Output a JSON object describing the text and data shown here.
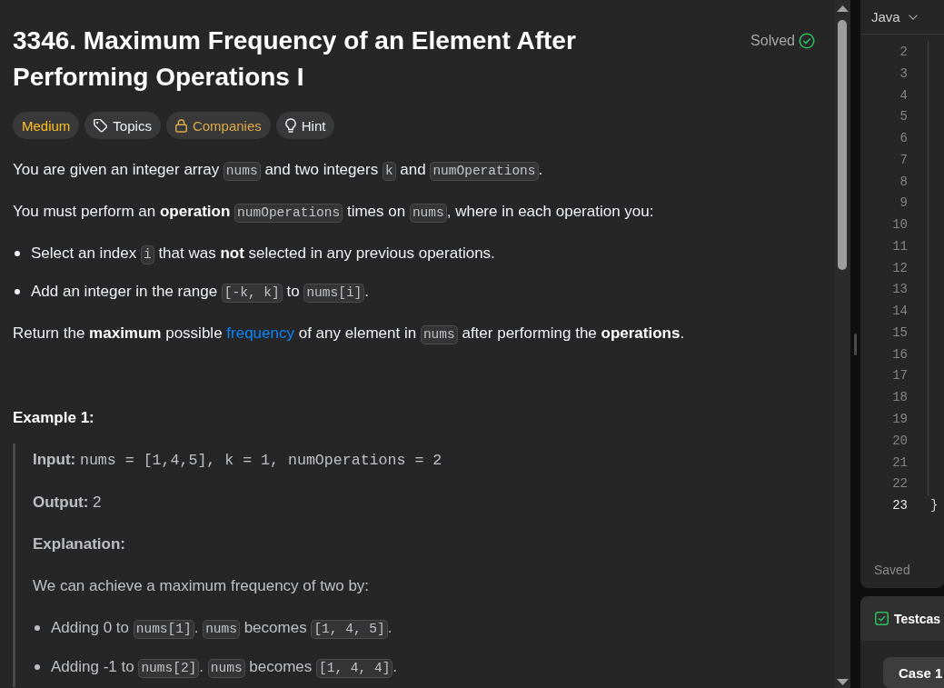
{
  "problem": {
    "title": "3346. Maximum Frequency of an Element After Performing Operations I",
    "status": {
      "label": "Solved",
      "solved": true
    },
    "tags": [
      {
        "kind": "difficulty",
        "label": "Medium"
      },
      {
        "kind": "topics",
        "label": "Topics"
      },
      {
        "kind": "companies",
        "label": "Companies",
        "locked": true
      },
      {
        "kind": "hint",
        "label": "Hint"
      }
    ],
    "description": [
      {
        "kind": "paragraph",
        "parts": [
          {
            "kind": "text",
            "text": "You are given an integer array "
          },
          {
            "kind": "code",
            "text": "nums"
          },
          {
            "kind": "text",
            "text": " and two integers "
          },
          {
            "kind": "code",
            "text": "k"
          },
          {
            "kind": "text",
            "text": " and "
          },
          {
            "kind": "code",
            "text": "numOperations"
          },
          {
            "kind": "text",
            "text": "."
          }
        ]
      },
      {
        "kind": "paragraph",
        "parts": [
          {
            "kind": "text",
            "text": "You must perform an **operation** "
          },
          {
            "kind": "code",
            "text": "numOperations"
          },
          {
            "kind": "text",
            "text": " times on "
          },
          {
            "kind": "code",
            "text": "nums"
          },
          {
            "kind": "text",
            "text": ", where in each operation you:"
          }
        ]
      },
      {
        "kind": "bullets",
        "items": [
          {
            "parts": [
              {
                "kind": "text",
                "text": "Select an index "
              },
              {
                "kind": "code",
                "text": "i"
              },
              {
                "kind": "text",
                "text": " that was **not** selected in any previous operations."
              }
            ]
          },
          {
            "parts": [
              {
                "kind": "text",
                "text": "Add an integer in the range "
              },
              {
                "kind": "code",
                "text": "[-k, k]"
              },
              {
                "kind": "text",
                "text": " to "
              },
              {
                "kind": "code",
                "text": "nums[i]"
              },
              {
                "kind": "text",
                "text": "."
              }
            ]
          }
        ]
      },
      {
        "kind": "paragraph",
        "parts": [
          {
            "kind": "text",
            "text": "Return the **maximum** possible "
          },
          {
            "kind": "link",
            "text": "frequency"
          },
          {
            "kind": "text",
            "text": " of any element in "
          },
          {
            "kind": "code",
            "text": "nums"
          },
          {
            "kind": "text",
            "text": " after performing the **operations**."
          }
        ]
      }
    ],
    "examples": [
      {
        "heading": "Example 1:",
        "blocks": [
          {
            "kind": "paragraph",
            "parts": [
              {
                "kind": "text",
                "text": "**Input:** "
              },
              {
                "kind": "mono",
                "text": "nums = [1,4,5], k = 1, numOperations = 2"
              }
            ]
          },
          {
            "kind": "paragraph",
            "parts": [
              {
                "kind": "text",
                "text": "**Output:** 2"
              }
            ]
          },
          {
            "kind": "label",
            "text": "Explanation:"
          },
          {
            "kind": "paragraph",
            "parts": [
              {
                "kind": "text",
                "text": "We can achieve a maximum frequency of two by:"
              }
            ]
          },
          {
            "kind": "bullets",
            "items": [
              {
                "parts": [
                  {
                    "kind": "text",
                    "text": "Adding 0 to "
                  },
                  {
                    "kind": "code",
                    "text": "nums[1]"
                  },
                  {
                    "kind": "text",
                    "text": ". "
                  },
                  {
                    "kind": "code",
                    "text": "nums"
                  },
                  {
                    "kind": "text",
                    "text": " becomes "
                  },
                  {
                    "kind": "code",
                    "text": "[1, 4, 5]"
                  },
                  {
                    "kind": "text",
                    "text": "."
                  }
                ]
              },
              {
                "parts": [
                  {
                    "kind": "text",
                    "text": "Adding -1 to "
                  },
                  {
                    "kind": "code",
                    "text": "nums[2]"
                  },
                  {
                    "kind": "text",
                    "text": ". "
                  },
                  {
                    "kind": "code",
                    "text": "nums"
                  },
                  {
                    "kind": "text",
                    "text": " becomes "
                  },
                  {
                    "kind": "code",
                    "text": "[1, 4, 4]"
                  },
                  {
                    "kind": "text",
                    "text": "."
                  }
                ]
              }
            ]
          }
        ]
      }
    ]
  },
  "editor": {
    "language": "Java",
    "lines": [
      {
        "number": "2",
        "active": false
      },
      {
        "number": "3",
        "active": false
      },
      {
        "number": "4",
        "active": false
      },
      {
        "number": "5",
        "active": false
      },
      {
        "number": "6",
        "active": false
      },
      {
        "number": "7",
        "active": false
      },
      {
        "number": "8",
        "active": false
      },
      {
        "number": "9",
        "active": false
      },
      {
        "number": "10",
        "active": false
      },
      {
        "number": "11",
        "active": false
      },
      {
        "number": "12",
        "active": false
      },
      {
        "number": "13",
        "active": false
      },
      {
        "number": "14",
        "active": false
      },
      {
        "number": "15",
        "active": false
      },
      {
        "number": "16",
        "active": false
      },
      {
        "number": "17",
        "active": false
      },
      {
        "number": "18",
        "active": false
      },
      {
        "number": "19",
        "active": false
      },
      {
        "number": "20",
        "active": false
      },
      {
        "number": "21",
        "active": false
      },
      {
        "number": "22",
        "active": false
      },
      {
        "number": "23",
        "active": true,
        "code": "}"
      }
    ],
    "status": "Saved"
  },
  "testcase": {
    "title": "Testcas",
    "cases": [
      {
        "label": "Case 1",
        "selected": true
      }
    ]
  }
}
